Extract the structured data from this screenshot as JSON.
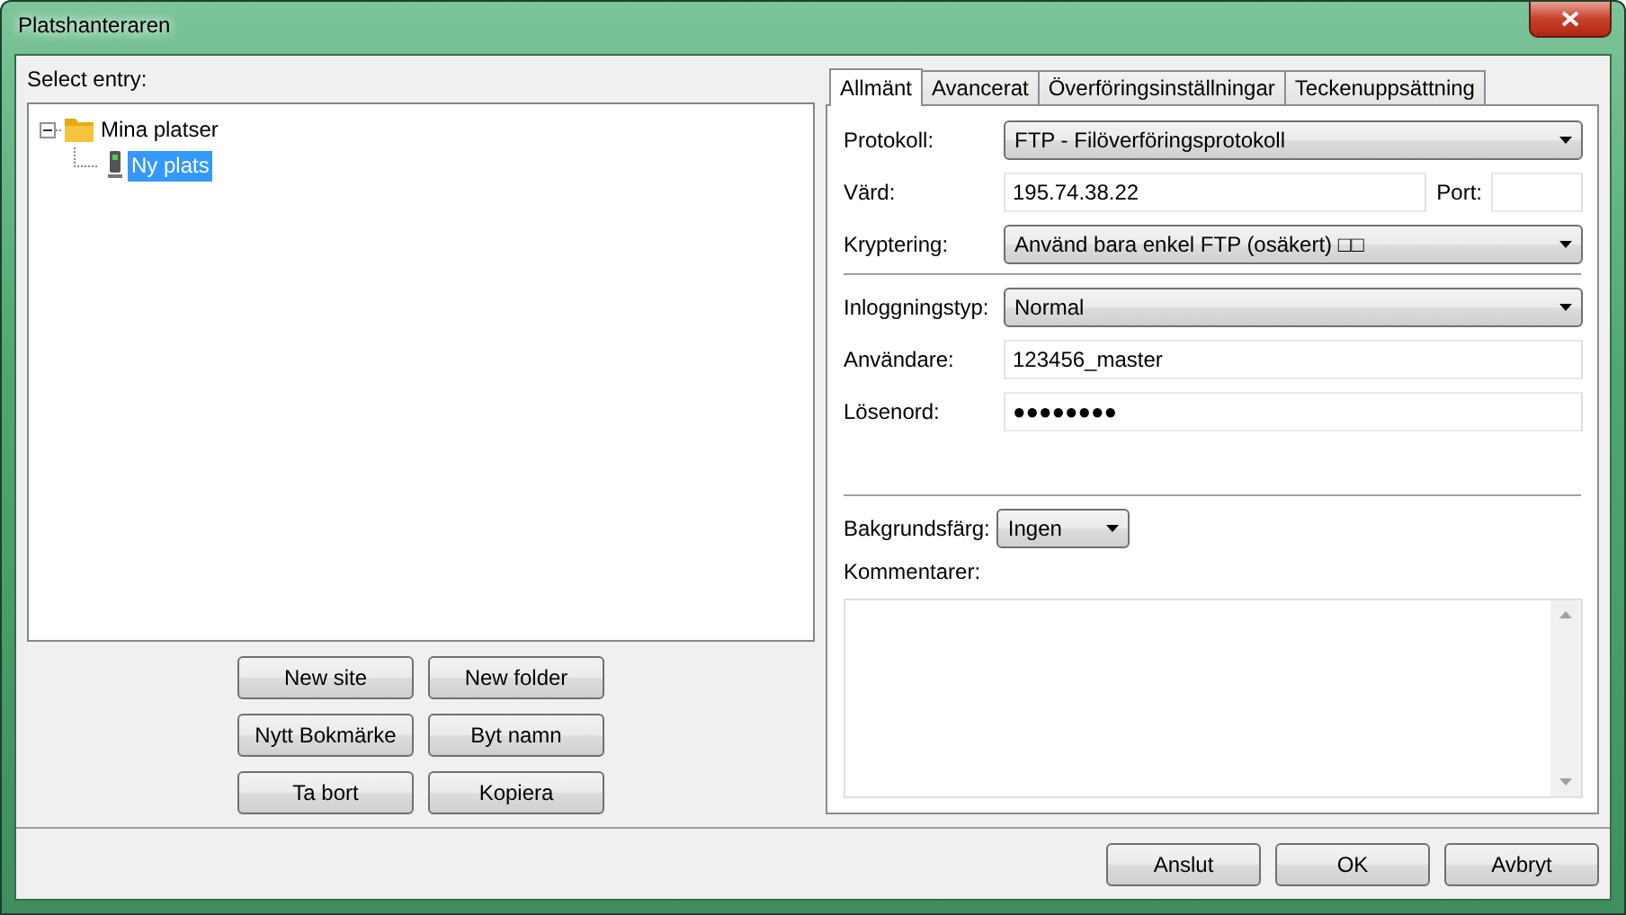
{
  "window": {
    "title": "Platshanteraren"
  },
  "sites": {
    "label": "Select entry:",
    "tree": [
      {
        "label": "Mina platser",
        "kind": "folder",
        "expanded": true,
        "selected": false,
        "children": [
          {
            "label": "Ny plats",
            "kind": "site",
            "selected": true
          }
        ]
      }
    ],
    "buttons": [
      "New site",
      "New folder",
      "Nytt Bokmärke",
      "Byt namn",
      "Ta bort",
      "Kopiera"
    ]
  },
  "tabs": [
    {
      "label": "Allmänt",
      "selected": true
    },
    {
      "label": "Avancerat",
      "selected": false
    },
    {
      "label": "Överföringsinställningar",
      "selected": false
    },
    {
      "label": "Teckenuppsättning",
      "selected": false
    }
  ],
  "general": {
    "protocol": {
      "label": "Protokoll:",
      "value": "FTP - Filöverföringsprotokoll"
    },
    "host": {
      "label": "Värd:",
      "value": "195.74.38.22"
    },
    "port": {
      "label": "Port:"
    },
    "encryption": {
      "label": "Kryptering:",
      "value": "Använd bara enkel FTP (osäkert) □□"
    },
    "logon_type": {
      "label": "Inloggningstyp:",
      "value": "Normal"
    },
    "user": {
      "label": "Användare:",
      "value": "123456_master"
    },
    "password": {
      "label": "Lösenord:",
      "value": "●●●●●●●●"
    },
    "background_color": {
      "label": "Bakgrundsfärg:",
      "value": "Ingen"
    },
    "comments": {
      "label": "Kommentarer:"
    }
  },
  "buttons": [
    "Anslut",
    "OK",
    "Avbryt"
  ]
}
